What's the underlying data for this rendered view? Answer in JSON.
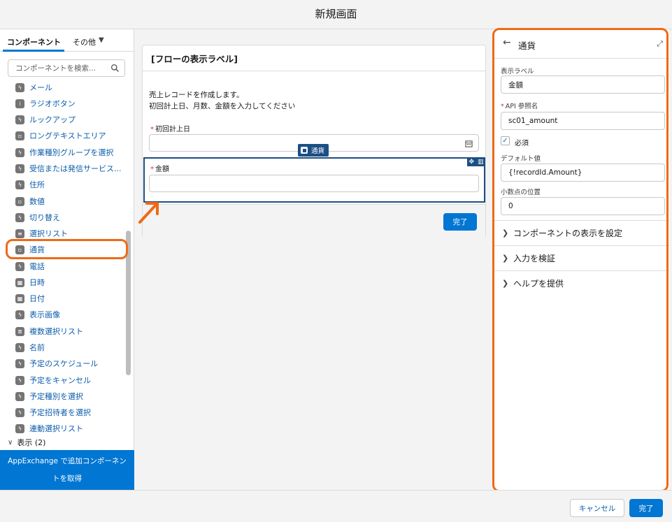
{
  "header": {
    "title": "新規画面"
  },
  "left_panel": {
    "tabs": [
      {
        "label": "コンポーネント"
      },
      {
        "label": "その他"
      }
    ],
    "search": {
      "placeholder": "コンポーネントを検索..."
    },
    "items": [
      {
        "label": "メール",
        "icon": "bolt-icon"
      },
      {
        "label": "ラジオボタン",
        "icon": "radio-icon"
      },
      {
        "label": "ルックアップ",
        "icon": "bolt-icon"
      },
      {
        "label": "ロングテキストエリア",
        "icon": "textarea-icon"
      },
      {
        "label": "作業種別グループを選択",
        "icon": "bolt-icon"
      },
      {
        "label": "受信または発信サービス...",
        "icon": "bolt-icon"
      },
      {
        "label": "住所",
        "icon": "bolt-icon"
      },
      {
        "label": "数値",
        "icon": "number-icon"
      },
      {
        "label": "切り替え",
        "icon": "bolt-icon"
      },
      {
        "label": "選択リスト",
        "icon": "list-icon"
      },
      {
        "label": "通貨",
        "icon": "currency-icon"
      },
      {
        "label": "電話",
        "icon": "bolt-icon"
      },
      {
        "label": "日時",
        "icon": "datetime-icon"
      },
      {
        "label": "日付",
        "icon": "date-icon"
      },
      {
        "label": "表示画像",
        "icon": "bolt-icon"
      },
      {
        "label": "複数選択リスト",
        "icon": "multiselect-icon"
      },
      {
        "label": "名前",
        "icon": "bolt-icon"
      },
      {
        "label": "予定のスケジュール",
        "icon": "bolt-icon"
      },
      {
        "label": "予定をキャンセル",
        "icon": "bolt-icon"
      },
      {
        "label": "予定種別を選択",
        "icon": "bolt-icon"
      },
      {
        "label": "予定招待者を選択",
        "icon": "bolt-icon"
      },
      {
        "label": "連動選択リスト",
        "icon": "bolt-icon"
      }
    ],
    "section": {
      "label": "表示 (2)"
    },
    "appexchange_line1": "AppExchange で追加コンポーネン",
    "appexchange_line2": "トを取得"
  },
  "canvas": {
    "card_title": "[フローの表示ラベル]",
    "desc_line1": "売上レコードを作成します。",
    "desc_line2": "初回計上日、月数、金額を入力してください",
    "field1_label": "初回計上日",
    "field2_label": "金額",
    "selected_tag": "通貨",
    "done_label": "完了"
  },
  "properties": {
    "title": "通貨",
    "display_label_caption": "表示ラベル",
    "display_label_value": "金額",
    "api_name_caption": "API 参照名",
    "api_name_value": "sc01_amount",
    "required_label": "必須",
    "required_checked": true,
    "default_caption": "デフォルト値",
    "default_value": "{!recordId.Amount}",
    "decimal_caption": "小数点の位置",
    "decimal_value": "0",
    "sections": [
      {
        "label": "コンポーネントの表示を設定"
      },
      {
        "label": "入力を検証"
      },
      {
        "label": "ヘルプを提供"
      }
    ]
  },
  "footer": {
    "cancel_label": "キャンセル",
    "finish_label": "完了"
  },
  "colors": {
    "accent": "#0176d3",
    "highlight": "#ee6a17",
    "selection": "#1b4f84"
  }
}
